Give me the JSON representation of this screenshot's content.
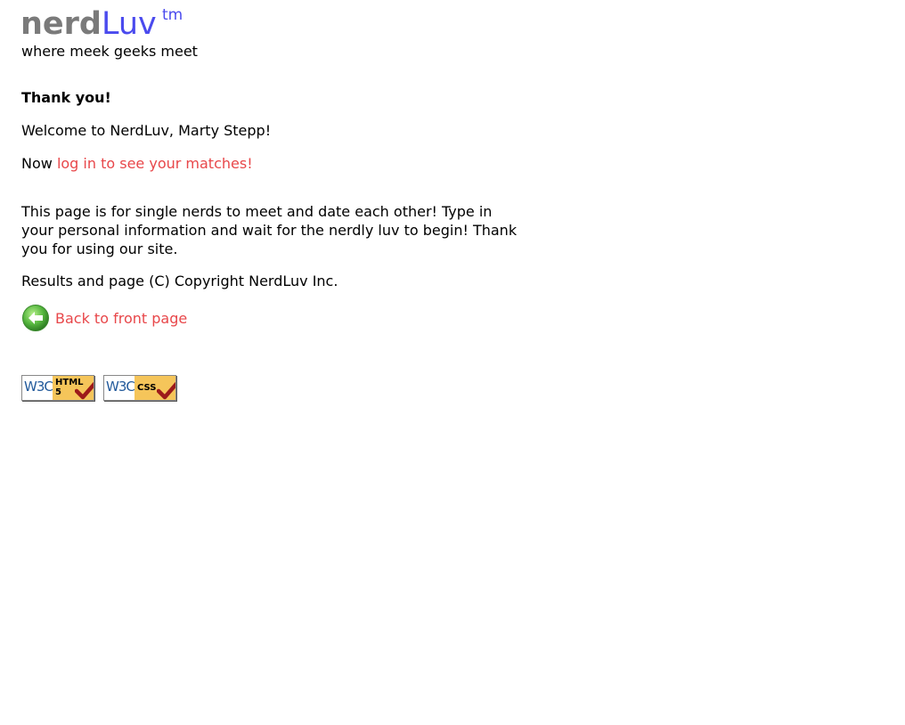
{
  "logo": {
    "nerd": "nerd",
    "luv": "Luv",
    "tm": "tm"
  },
  "tagline": "where meek geeks meet",
  "heading": "Thank you!",
  "welcome": "Welcome to NerdLuv, Marty Stepp!",
  "login": {
    "prefix": "Now",
    "link_text": "log in to see your matches!"
  },
  "intro": "This page is for single nerds to meet and date each other! Type in your personal information and wait for the nerdly luv to begin! Thank you for using our site.",
  "copyright": "Results and page (C) Copyright NerdLuv Inc.",
  "back_link": {
    "icon": "back-arrow-icon",
    "label": "Back to front page"
  },
  "badges": [
    {
      "org": "W3C",
      "label_line1": "HTML",
      "label_line2": "5"
    },
    {
      "org": "W3C",
      "label_line1": "CSS",
      "label_line2": ""
    }
  ],
  "colors": {
    "logo_gray": "#7a7a7a",
    "logo_blue": "#4a4aee",
    "link": "#e8474a",
    "badge_panel": "#f5c55a",
    "back_icon_green": "#4caf3a"
  }
}
